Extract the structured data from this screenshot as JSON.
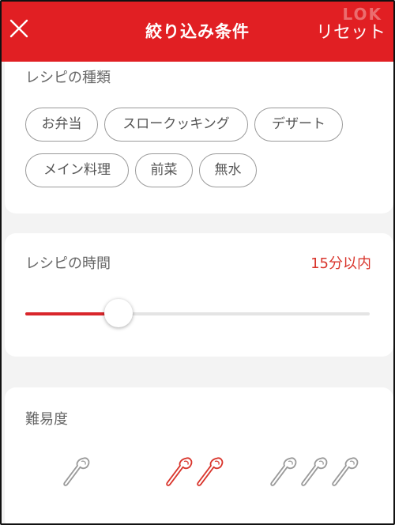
{
  "header": {
    "title": "絞り込み条件",
    "reset_label": "リセット",
    "watermark": "LOK"
  },
  "recipe_type": {
    "label": "レシピの種類",
    "chips": [
      "お弁当",
      "スロークッキング",
      "デザート",
      "メイン料理",
      "前菜",
      "無水"
    ]
  },
  "recipe_time": {
    "label": "レシピの時間",
    "value": "15分以内",
    "slider_fraction": 0.27,
    "fill_color": "#d9262b"
  },
  "difficulty": {
    "label": "難易度",
    "levels": [
      {
        "spoons": 1,
        "selected": false
      },
      {
        "spoons": 2,
        "selected": true
      },
      {
        "spoons": 3,
        "selected": false
      }
    ],
    "selected_color": "#d9352c",
    "unselected_color": "#9a9a9a"
  },
  "colors": {
    "header_bg": "#e11f23",
    "accent": "#d9352c"
  },
  "icons": {
    "close": "close-icon",
    "spoon": "spoon-icon"
  }
}
